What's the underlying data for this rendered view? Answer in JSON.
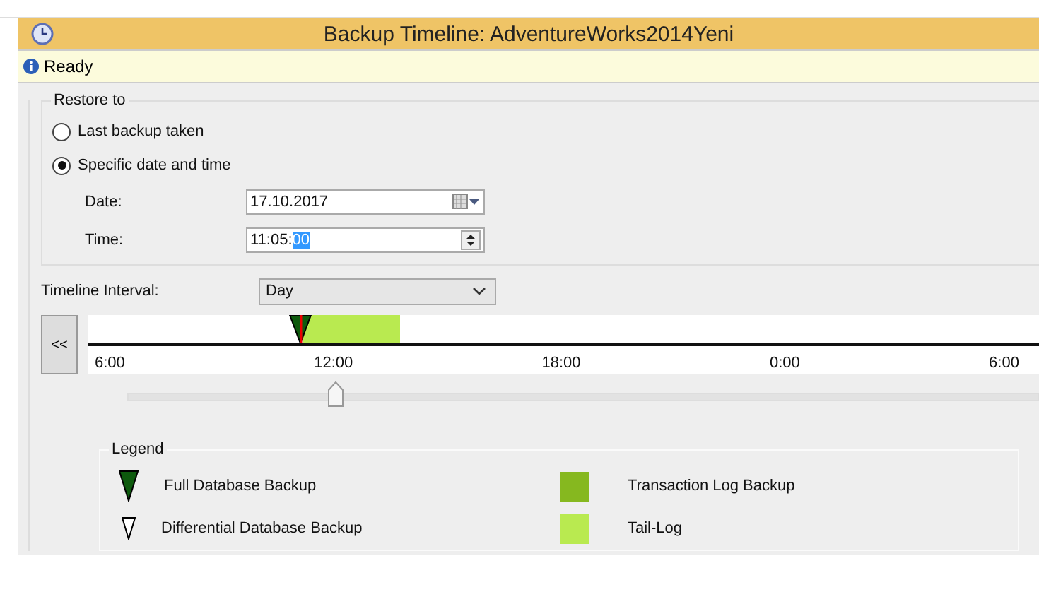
{
  "window": {
    "title": "Backup Timeline: AdventureWorks2014Yeni"
  },
  "status": {
    "text": "Ready"
  },
  "restore_to": {
    "title": "Restore to",
    "options": [
      {
        "label": "Last backup taken",
        "selected": false
      },
      {
        "label": "Specific date and time",
        "selected": true
      }
    ],
    "date": {
      "label": "Date:",
      "value": "17.10.2017"
    },
    "time": {
      "label": "Time:",
      "value": "11:05:",
      "selected_part": "00"
    }
  },
  "timeline": {
    "interval_label": "Timeline Interval:",
    "interval": "Day",
    "back_button": "<<",
    "ticks": [
      "6:00",
      "12:00",
      "18:00",
      "0:00",
      "6:00"
    ],
    "slider": {
      "level": 0.22
    }
  },
  "legend": {
    "title": "Legend",
    "items": [
      {
        "kind": "full",
        "label": "Full Database Backup"
      },
      {
        "kind": "log",
        "label": "Transaction Log Backup",
        "color": "#86b81f"
      },
      {
        "kind": "differential",
        "label": "Differential Database Backup"
      },
      {
        "kind": "tail",
        "label": "Tail-Log",
        "color": "#b9ea50"
      }
    ]
  }
}
